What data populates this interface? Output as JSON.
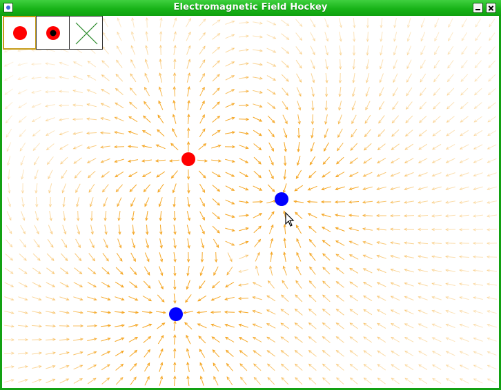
{
  "window": {
    "title": "Electromagnetic Field Hockey",
    "controls": [
      "minimize-icon",
      "close-icon"
    ],
    "titlebar_color": "#18b418",
    "frame_color": "#12a112"
  },
  "toolbar": {
    "tools": [
      {
        "name": "positive-charge-tool",
        "icon": "red-dot-icon",
        "selected": true
      },
      {
        "name": "puck-tool",
        "icon": "red-ring-black-dot-icon",
        "selected": false
      },
      {
        "name": "delete-tool",
        "icon": "green-x-icon",
        "selected": false
      }
    ]
  },
  "field": {
    "arrow_color": "#f5a623",
    "charges": [
      {
        "name": "positive-charge",
        "color": "#ff0000",
        "sign": "+"
      },
      {
        "name": "negative-charge-1",
        "color": "#0000ff",
        "sign": "-"
      },
      {
        "name": "negative-charge-2",
        "color": "#0000ff",
        "sign": "-"
      }
    ]
  }
}
